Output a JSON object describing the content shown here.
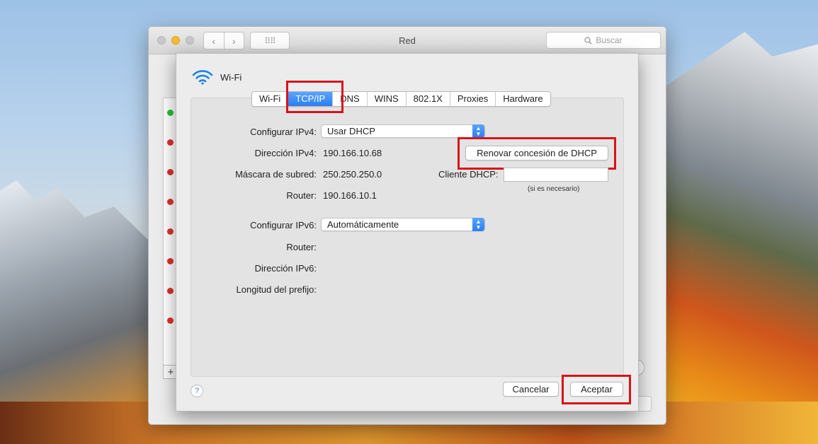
{
  "window": {
    "title": "Red",
    "search_placeholder": "Buscar",
    "back_glyph": "‹",
    "forward_glyph": "›",
    "grid_glyph": "⠿⠿"
  },
  "sheet": {
    "interface_name": "Wi-Fi",
    "tabs": [
      {
        "label": "Wi-Fi",
        "active": false
      },
      {
        "label": "TCP/IP",
        "active": true
      },
      {
        "label": "DNS",
        "active": false
      },
      {
        "label": "WINS",
        "active": false
      },
      {
        "label": "802.1X",
        "active": false
      },
      {
        "label": "Proxies",
        "active": false
      },
      {
        "label": "Hardware",
        "active": false
      }
    ],
    "ipv4": {
      "configure_label": "Configurar IPv4:",
      "configure_value": "Usar DHCP",
      "address_label": "Dirección IPv4:",
      "address_value": "190.166.10.68",
      "mask_label": "Máscara de subred:",
      "mask_value": "250.250.250.0",
      "router_label": "Router:",
      "router_value": "190.166.10.1"
    },
    "dhcp": {
      "renew_label": "Renovar concesión de DHCP",
      "client_label": "Cliente DHCP:",
      "client_value": "",
      "client_note": "(si es necesario)"
    },
    "ipv6": {
      "configure_label": "Configurar IPv6:",
      "configure_value": "Automáticamente",
      "router_label": "Router:",
      "address_label": "Dirección IPv6:",
      "prefix_label": "Longitud del prefijo:"
    },
    "buttons": {
      "help": "?",
      "cancel": "Cancelar",
      "ok": "Aceptar"
    }
  },
  "sidebar": {
    "add_label": "+",
    "status_colors": [
      "#2bbd3a",
      "#e0302e",
      "#e0302e",
      "#e0302e",
      "#e0302e",
      "#e0302e",
      "#e0302e",
      "#e0302e"
    ]
  },
  "highlight_color": "#d7141a",
  "accent_color": "#2a7ef0"
}
